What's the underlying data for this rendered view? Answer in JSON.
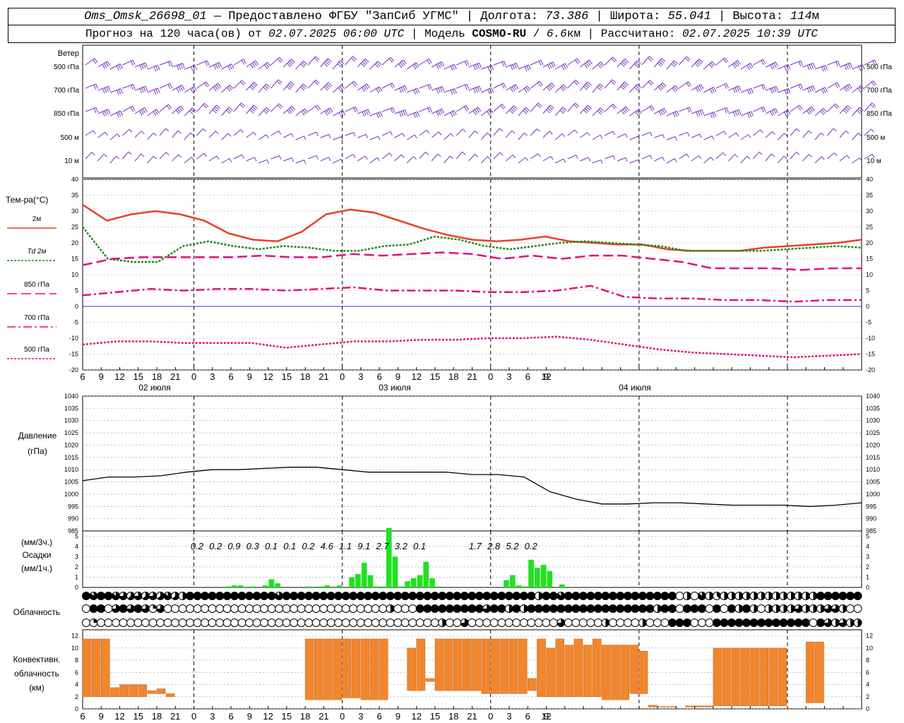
{
  "header": {
    "station": "Oms_Omsk_26698_01",
    "provider": "— Предоставлено ФГБУ \"ЗапСиб УГМС\"",
    "lon_label": "Долгота:",
    "lon": "73.386",
    "lat_label": "Широта:",
    "lat": "55.041",
    "alt_label": "Высота:",
    "alt": "114",
    "alt_unit": "м",
    "forecast_label": "Прогноз на 120 часа(ов) от",
    "forecast_from": "02.07.2025 06:00 UTC",
    "model_label": "Модель",
    "model": "COSMO-RU",
    "model_res": "6.6",
    "model_res_unit": "км",
    "calc_label": "Рассчитано:",
    "calc_time": "02.07.2025 10:39 UTC"
  },
  "chart_data": [
    {
      "type": "barbs",
      "panel": "wind",
      "title": "Ветер",
      "levels": [
        "500 гПа",
        "700 гПа",
        "850 гПа",
        "500 м",
        "10 м"
      ],
      "right_levels": [
        "500 гПа",
        "700 гПа",
        "850 гПа",
        "500 м",
        "10 м"
      ],
      "note": "wind barbs per level every hour"
    },
    {
      "type": "line",
      "panel": "temperature",
      "ylabel": "Тем-ра(°C)",
      "ylim": [
        -20,
        40
      ],
      "yticks": [
        -20,
        -15,
        -10,
        -5,
        0,
        5,
        10,
        15,
        20,
        25,
        30,
        35,
        40
      ],
      "x_hours": [
        0,
        3,
        6,
        9,
        12,
        15,
        18,
        21,
        24,
        27,
        30,
        33,
        36,
        39,
        42,
        45,
        48,
        51,
        54,
        57,
        60,
        63,
        66,
        69,
        72,
        75,
        78,
        81,
        84,
        87,
        90,
        93,
        96,
        99,
        102,
        105,
        108,
        111,
        114,
        117,
        120
      ],
      "series": [
        {
          "name": "2м",
          "color": "#e8402c",
          "style": "solid",
          "values": [
            32,
            27,
            29,
            30,
            29,
            27,
            23,
            21,
            20.5,
            23.5,
            29,
            30.5,
            29.5,
            27,
            24.5,
            22.5,
            21,
            20.5,
            21,
            22,
            20.5,
            20,
            19.5,
            19.5,
            18,
            17.5,
            17.5,
            17.5,
            18.5,
            19,
            19.5,
            20,
            21
          ]
        },
        {
          "name": "Td 2м",
          "color": "#138a13",
          "style": "dotted",
          "values": [
            25,
            15,
            14,
            14,
            19,
            20.5,
            19,
            18,
            19,
            18.5,
            17.5,
            17.5,
            19,
            19.5,
            22,
            21,
            19,
            18,
            19,
            20,
            20.5,
            20,
            19.5,
            19,
            17.5,
            17.5,
            17.5,
            17.5,
            18,
            18.5,
            19,
            18.5
          ]
        },
        {
          "name": "850 гПа",
          "color": "#e0107a",
          "style": "longdash",
          "values": [
            13,
            15,
            15.5,
            15.5,
            15.5,
            15.5,
            16,
            15.5,
            15.5,
            16.5,
            16,
            16.5,
            17,
            16.5,
            15,
            16,
            15,
            16,
            16,
            15,
            14,
            12,
            12,
            12,
            11.5,
            12,
            12
          ]
        },
        {
          "name": "700 гПа",
          "color": "#e0107a",
          "style": "dashdot",
          "values": [
            3.5,
            4.5,
            5.5,
            5,
            5.5,
            5.5,
            5,
            5.5,
            6,
            5,
            5,
            5,
            4.5,
            4.5,
            5,
            6.5,
            3,
            2.5,
            2.5,
            2,
            2,
            1.5,
            2,
            2
          ]
        },
        {
          "name": "500 гПа",
          "color": "#e0107a",
          "style": "dotted",
          "values": [
            -12,
            -11,
            -11,
            -11.5,
            -11.5,
            -11.5,
            -13,
            -12,
            -11,
            -11,
            -10.5,
            -10.5,
            -10,
            -10,
            -9.5,
            -10.5,
            -12,
            -13.5,
            -14.5,
            -15,
            -15.5,
            -16,
            -15.5,
            -15
          ]
        }
      ]
    },
    {
      "type": "line",
      "panel": "pressure",
      "ylabel": "Давление",
      "unit": "(гПа)",
      "ylim": [
        985,
        1040
      ],
      "yticks": [
        985,
        990,
        995,
        1000,
        1005,
        1010,
        1015,
        1020,
        1025,
        1030,
        1035,
        1040
      ],
      "values": [
        1005.5,
        1007,
        1007,
        1007.5,
        1009,
        1010,
        1010,
        1010.5,
        1011,
        1011,
        1010,
        1009,
        1009,
        1009,
        1009,
        1008,
        1008,
        1007,
        1001,
        998,
        996,
        996,
        996.5,
        996.5,
        996,
        995.5,
        995.5,
        995.5,
        995,
        995.5,
        996.5
      ]
    },
    {
      "type": "bar",
      "panel": "precipitation",
      "ylabel": "Осадки",
      "unit_3h": "(мм/3ч.)",
      "unit_1h": "(мм/1ч.)",
      "ylim": [
        0,
        5.5
      ],
      "totals_3h": [
        {
          "hour": 24,
          "value": "0.2"
        },
        {
          "hour": 27,
          "value": "0.2"
        },
        {
          "hour": 30,
          "value": "0.9"
        },
        {
          "hour": 33,
          "value": "0.3"
        },
        {
          "hour": 36,
          "value": "0.1"
        },
        {
          "hour": 39,
          "value": "0.1"
        },
        {
          "hour": 42,
          "value": "0.2"
        },
        {
          "hour": 45,
          "value": "4.6"
        },
        {
          "hour": 48,
          "value": "1.1"
        },
        {
          "hour": 51,
          "value": "9.1"
        },
        {
          "hour": 54,
          "value": "2.7"
        },
        {
          "hour": 57,
          "value": "3.2"
        },
        {
          "hour": 60,
          "value": "0.1"
        },
        {
          "hour": 69,
          "value": "1.7"
        },
        {
          "hour": 72,
          "value": "2.8"
        },
        {
          "hour": 75,
          "value": "5.2"
        },
        {
          "hour": 78,
          "value": "0.2"
        }
      ],
      "bars_hourly": [
        [
          23,
          0.1
        ],
        [
          24,
          0.2
        ],
        [
          25,
          0.2
        ],
        [
          27,
          0.1
        ],
        [
          29,
          0.2
        ],
        [
          30,
          0.8
        ],
        [
          31,
          0.4
        ],
        [
          36,
          0.1
        ],
        [
          38,
          0.1
        ],
        [
          39,
          0.2
        ],
        [
          41,
          0.2
        ],
        [
          43,
          1
        ],
        [
          44,
          1.3
        ],
        [
          45,
          2.4
        ],
        [
          46,
          1.2
        ],
        [
          47,
          0.1
        ],
        [
          48,
          0.1
        ],
        [
          49,
          5.8
        ],
        [
          50,
          3
        ],
        [
          51,
          0.1
        ],
        [
          52,
          0.6
        ],
        [
          53,
          0.9
        ],
        [
          54,
          1.2
        ],
        [
          55,
          2.5
        ],
        [
          56,
          0.9
        ],
        [
          57,
          0.1
        ],
        [
          68,
          0.7
        ],
        [
          69,
          1.2
        ],
        [
          70,
          0.2
        ],
        [
          71,
          0.1
        ],
        [
          72,
          2.7
        ],
        [
          73,
          1.9
        ],
        [
          74,
          2.2
        ],
        [
          75,
          1.6
        ],
        [
          77,
          0.3
        ]
      ]
    },
    {
      "type": "table",
      "panel": "cloudiness",
      "ylabel": "Облачность",
      "rows": [
        "upper",
        "middle",
        "lower"
      ],
      "note": "cloud-cover symbols per hour (0-8 octas)",
      "upper": [
        8,
        7,
        8,
        8,
        7,
        6,
        5,
        6,
        5,
        6,
        5,
        7,
        5,
        4,
        8,
        8,
        8,
        8,
        8,
        8,
        8,
        8,
        8,
        8,
        8,
        8,
        7,
        8,
        8,
        8,
        8,
        8,
        8,
        8,
        8,
        8,
        8,
        8,
        8,
        8,
        8,
        8,
        8,
        8,
        8,
        8,
        8,
        8,
        8,
        8,
        8,
        8,
        8,
        8,
        8,
        8,
        8,
        8,
        8,
        8,
        8,
        4,
        8,
        8,
        7,
        8,
        8,
        8,
        8,
        8,
        8,
        8,
        8,
        8,
        8,
        8,
        8,
        8,
        8,
        8,
        0,
        4,
        0,
        7,
        4,
        3,
        4,
        4,
        4,
        4,
        4,
        4,
        4,
        4,
        4,
        4,
        4,
        4,
        4,
        8,
        8,
        8,
        8,
        8,
        8
      ],
      "middle": [
        0,
        8,
        8,
        0,
        6,
        8,
        6,
        8,
        6,
        2,
        6,
        0,
        0,
        0,
        0,
        0,
        0,
        0,
        0,
        0,
        0,
        0,
        0,
        0,
        0,
        0,
        0,
        0,
        0,
        0,
        0,
        0,
        0,
        0,
        0,
        0,
        0,
        0,
        0,
        0,
        0,
        4,
        0,
        0,
        0,
        8,
        8,
        8,
        8,
        8,
        8,
        8,
        8,
        8,
        6,
        8,
        8,
        4,
        8,
        4,
        8,
        8,
        8,
        8,
        8,
        8,
        8,
        8,
        8,
        8,
        8,
        8,
        8,
        8,
        8,
        8,
        8,
        4,
        8,
        8,
        0,
        8,
        8,
        8,
        0,
        8,
        0,
        8,
        4,
        8,
        4,
        0,
        4,
        4,
        4,
        4,
        6,
        4,
        4,
        4,
        6,
        6,
        4
      ],
      "lower": [
        0,
        2,
        0,
        0,
        0,
        0,
        0,
        0,
        0,
        0,
        0,
        0,
        0,
        0,
        0,
        0,
        0,
        0,
        0,
        0,
        0,
        0,
        0,
        0,
        0,
        0,
        0,
        0,
        0,
        0,
        0,
        0,
        0,
        0,
        0,
        0,
        0,
        0,
        0,
        0,
        0,
        0,
        0,
        0,
        0,
        0,
        0,
        0,
        4,
        0,
        0,
        6,
        0,
        0,
        0,
        0,
        0,
        0,
        0,
        0,
        0,
        0,
        0,
        0,
        6,
        0,
        0,
        0,
        0,
        0,
        4,
        0,
        0,
        0,
        0,
        4,
        0,
        0,
        0,
        8,
        8,
        8,
        0,
        0,
        0,
        8,
        8,
        8,
        8,
        8,
        8,
        8,
        8,
        8,
        8,
        8,
        8,
        8,
        0,
        8,
        6,
        4,
        6,
        4,
        4
      ]
    },
    {
      "type": "bar",
      "panel": "convective_cloud",
      "ylabel": [
        "Конвективн.",
        "облачность",
        "(км)"
      ],
      "ylim": [
        0,
        13
      ],
      "yticks": [
        0,
        2,
        4,
        6,
        8,
        10,
        12
      ],
      "bars_hourly": [
        [
          0,
          2,
          11.5
        ],
        [
          1,
          2,
          11.5
        ],
        [
          2,
          2,
          11.5
        ],
        [
          3,
          2,
          3.5
        ],
        [
          4,
          2,
          4
        ],
        [
          5,
          2,
          4
        ],
        [
          6,
          2,
          4
        ],
        [
          7,
          2.5,
          3
        ],
        [
          8,
          2.5,
          3.3
        ],
        [
          9,
          2,
          2.5
        ],
        [
          24,
          1.5,
          11.5
        ],
        [
          25,
          1.5,
          11.5
        ],
        [
          26,
          1.5,
          11.5
        ],
        [
          27,
          1.5,
          11.5
        ],
        [
          28,
          1.8,
          11.5
        ],
        [
          29,
          1.8,
          11.5
        ],
        [
          30,
          1.5,
          11.5
        ],
        [
          31,
          1.5,
          11.5
        ],
        [
          32,
          1.5,
          11.5
        ],
        [
          35,
          3,
          10
        ],
        [
          36,
          3,
          11.5
        ],
        [
          37,
          4.5,
          5
        ],
        [
          38,
          3,
          11.5
        ],
        [
          39,
          3,
          11.5
        ],
        [
          40,
          3,
          11.5
        ],
        [
          41,
          3,
          11.5
        ],
        [
          42,
          3,
          11.5
        ],
        [
          43,
          2.5,
          11.5
        ],
        [
          44,
          2.5,
          11.5
        ],
        [
          45,
          2.5,
          11.5
        ],
        [
          46,
          2.5,
          11.5
        ],
        [
          47,
          2.5,
          11.5
        ],
        [
          48,
          3,
          5
        ],
        [
          49,
          2,
          11.5
        ],
        [
          50,
          2,
          10
        ],
        [
          51,
          2,
          11.5
        ],
        [
          52,
          2,
          10.5
        ],
        [
          53,
          2,
          11.5
        ],
        [
          54,
          2,
          10.5
        ],
        [
          55,
          2,
          11.5
        ],
        [
          56,
          1.5,
          10.5
        ],
        [
          57,
          1.5,
          10.5
        ],
        [
          58,
          1.5,
          10.5
        ],
        [
          59,
          2.5,
          10.5
        ],
        [
          60,
          2.5,
          9.5
        ],
        [
          61,
          0.3,
          0.6
        ],
        [
          62,
          0.3,
          0.4
        ],
        [
          63,
          0.3,
          0.4
        ],
        [
          64,
          0.3,
          0.3
        ],
        [
          65,
          0.3,
          0.5
        ],
        [
          66,
          0.3,
          0.5
        ],
        [
          67,
          0.3,
          0.5
        ],
        [
          68,
          0.5,
          10
        ],
        [
          69,
          0.5,
          10
        ],
        [
          70,
          0.5,
          10
        ],
        [
          71,
          0.5,
          10
        ],
        [
          72,
          0.5,
          10
        ],
        [
          73,
          0.5,
          10
        ],
        [
          74,
          0.5,
          10
        ],
        [
          75,
          0.5,
          10
        ],
        [
          78,
          1,
          11
        ],
        [
          79,
          1,
          11
        ]
      ]
    }
  ],
  "time_axis": {
    "hour_labels": [
      "6",
      "9",
      "12",
      "15",
      "18",
      "21",
      "0",
      "3",
      "6",
      "9",
      "12",
      "15",
      "18",
      "21",
      "0",
      "3",
      "6",
      "9",
      "12",
      "15",
      "18",
      "21",
      "0",
      "3",
      "6",
      "9",
      "12"
    ],
    "day_labels": [
      "02 июля",
      "03 июля",
      "04 июля"
    ],
    "colors": {
      "temp": "#e8402c",
      "td": "#138a13",
      "isobaric": "#e0107a",
      "wind": "#7a2fc0",
      "precip": "#22e022",
      "conv": "#f0862e",
      "zero_line": "#3030d0"
    }
  }
}
